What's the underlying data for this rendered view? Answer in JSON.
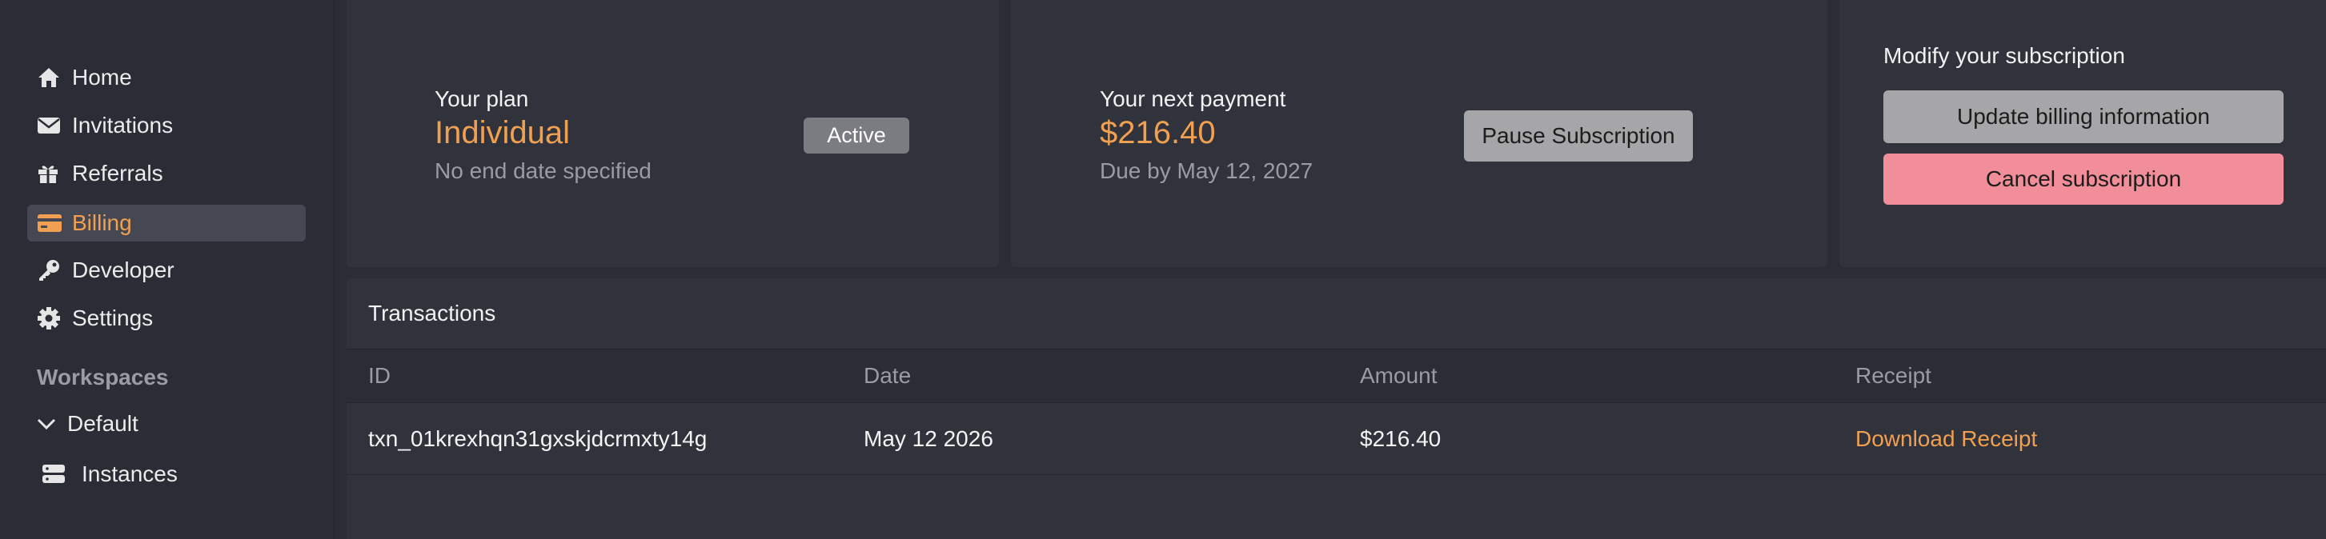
{
  "sidebar": {
    "items": [
      {
        "label": "Home",
        "icon": "home-icon"
      },
      {
        "label": "Invitations",
        "icon": "envelope-icon"
      },
      {
        "label": "Referrals",
        "icon": "gift-icon"
      },
      {
        "label": "Billing",
        "icon": "credit-card-icon",
        "active": true
      },
      {
        "label": "Developer",
        "icon": "key-icon"
      },
      {
        "label": "Settings",
        "icon": "gear-icon"
      }
    ],
    "workspaces_heading": "Workspaces",
    "workspace_default": "Default",
    "workspace_instances": "Instances"
  },
  "plan": {
    "label": "Your plan",
    "name": "Individual",
    "sub": "No end date specified",
    "status": "Active"
  },
  "payment": {
    "label": "Your next payment",
    "amount": "$216.40",
    "due": "Due by May 12, 2027",
    "pause_label": "Pause Subscription"
  },
  "modify": {
    "label": "Modify your subscription",
    "update_label": "Update billing information",
    "cancel_label": "Cancel subscription"
  },
  "transactions": {
    "title": "Transactions",
    "columns": [
      "ID",
      "Date",
      "Amount",
      "Receipt"
    ],
    "rows": [
      {
        "id": "txn_01krexhqn31gxskjdcrmxty14g",
        "date": "May 12 2026",
        "amount": "$216.40",
        "receipt": "Download Receipt"
      }
    ]
  },
  "colors": {
    "accent": "#f0a050",
    "background": "#2a2d35",
    "card": "#30333c",
    "danger": "#f18e99",
    "button_gray": "#a6a6a8"
  }
}
